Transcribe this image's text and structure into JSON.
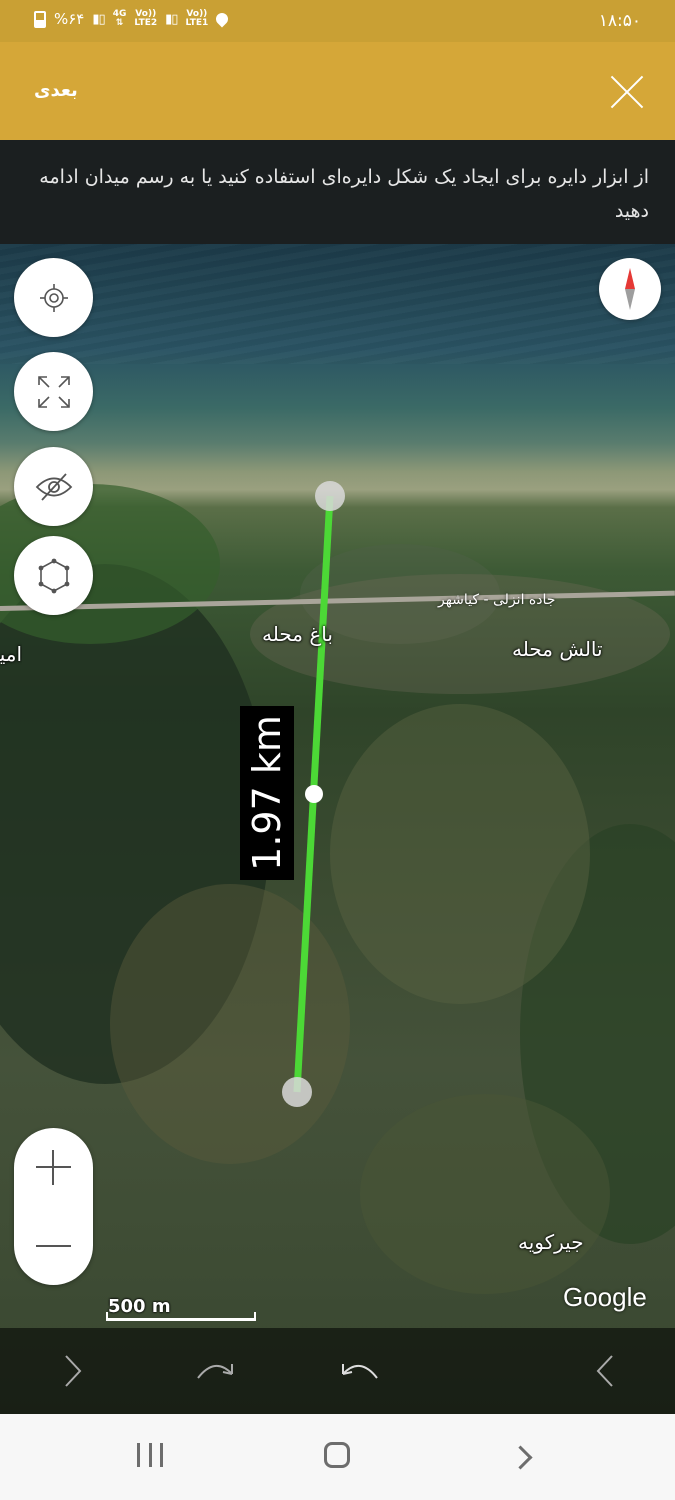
{
  "status_bar": {
    "battery": "%۶۴",
    "network_1": "4G",
    "network_2_top": "Vo))",
    "network_2_bottom": "LTE2",
    "network_3_top": "Vo))",
    "network_3_bottom": "LTE1",
    "time": "۱۸:۵۰"
  },
  "header": {
    "next_label": "بعدی",
    "close_icon": "close-icon",
    "background": "#d5a738"
  },
  "hint": {
    "text": "از ابزار دایره برای ایجاد یک شکل دایره‌ای استفاده کنید یا به رسم میدان ادامه دهید"
  },
  "map": {
    "places": {
      "bagh_mahalleh": "باغ محله",
      "talesh_mahalleh": "تالش محله",
      "jirkuyeh": "جیرکویه",
      "partial_left": "امیر"
    },
    "road_label": "جاده انزلی - کیاشهر",
    "distance_label": "1.97 km",
    "scale_label": "500 m",
    "attribution": "Google",
    "measure_line_color": "#4cd836"
  },
  "controls": {
    "locate_icon": "crosshair-icon",
    "fullscreen_icon": "expand-icon",
    "visibility_icon": "eye-off-icon",
    "polygon_icon": "polygon-icon",
    "compass_icon": "compass-icon",
    "zoom_in_icon": "plus-icon",
    "zoom_out_icon": "minus-icon"
  },
  "action_bar": {
    "items": [
      "forward-icon",
      "redo-icon",
      "undo-icon",
      "back-icon"
    ]
  },
  "nav_bar": {
    "items": [
      "recent-apps-icon",
      "home-icon",
      "back-icon"
    ]
  }
}
